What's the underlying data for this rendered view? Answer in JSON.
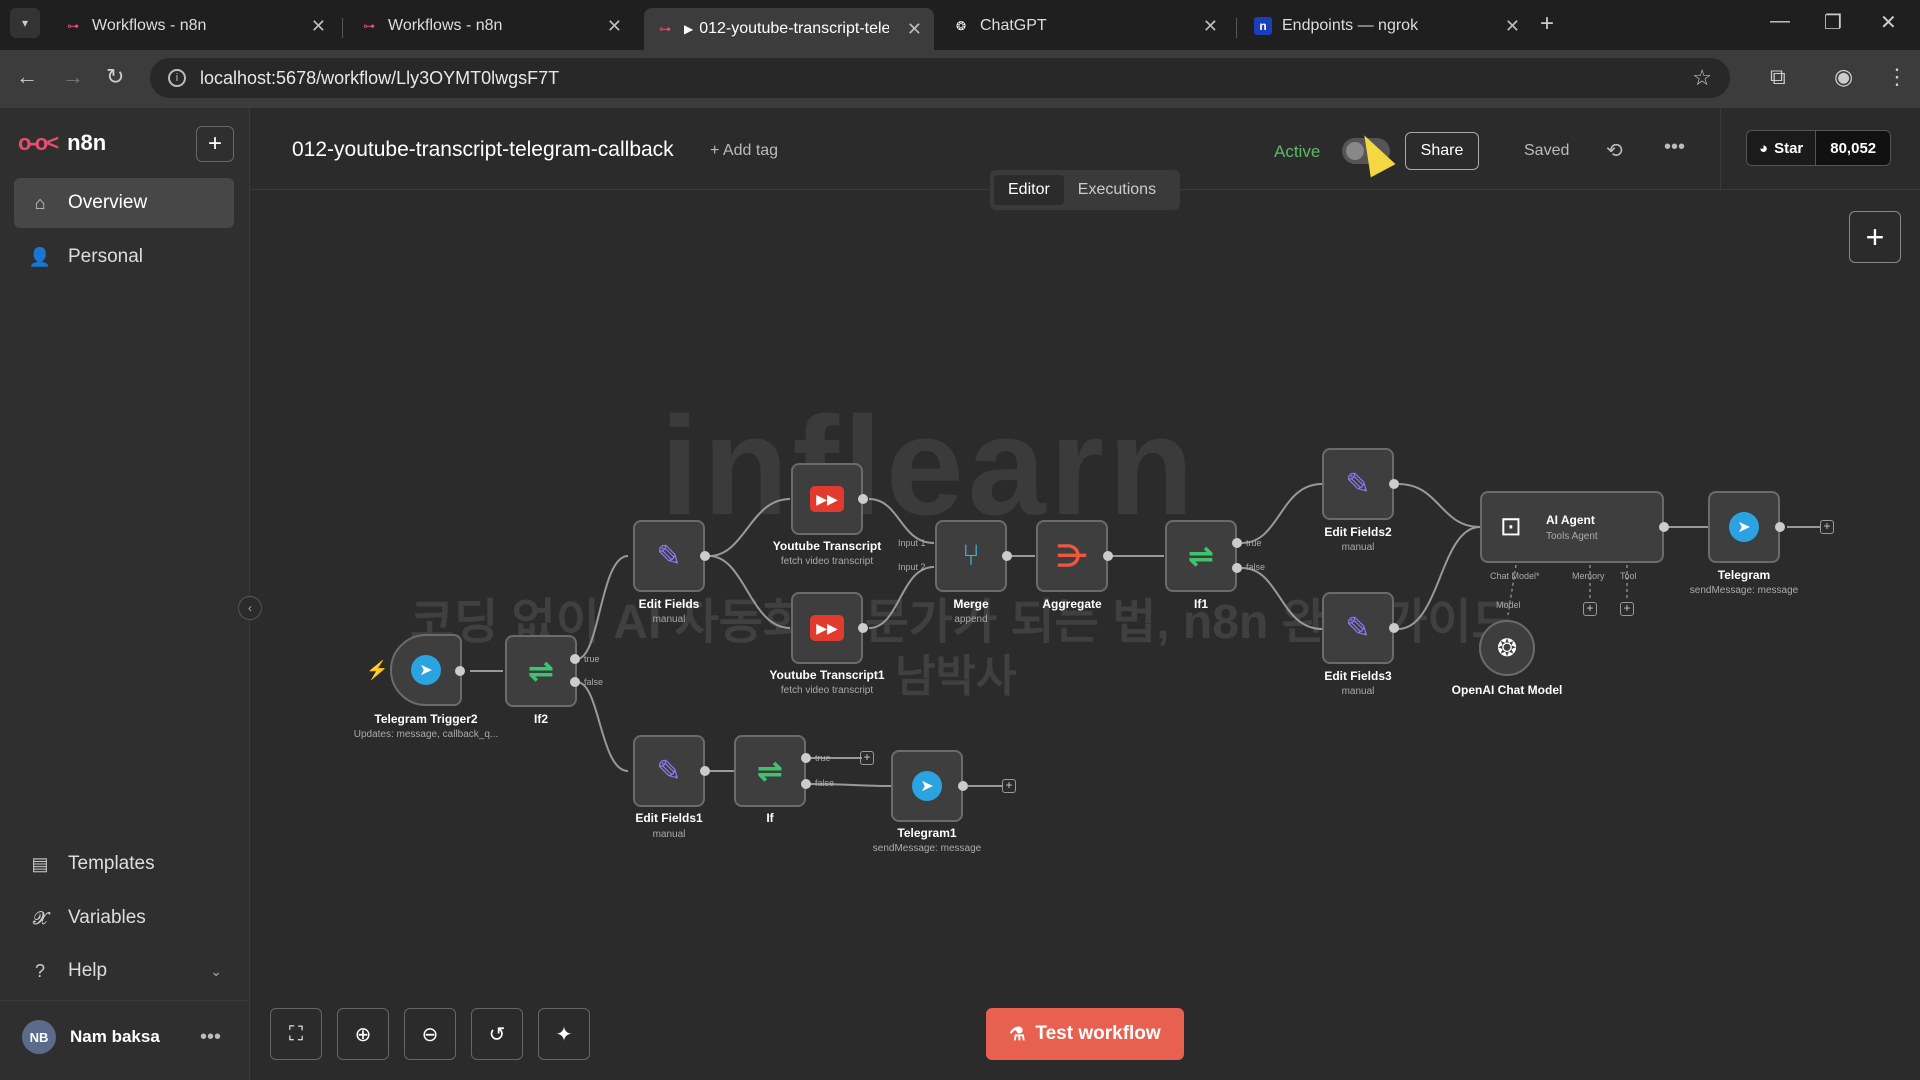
{
  "browser": {
    "tabs": [
      {
        "title": "Workflows - n8n",
        "active": false
      },
      {
        "title": "Workflows - n8n",
        "active": false
      },
      {
        "title": "012-youtube-transcript-tele",
        "active": true
      },
      {
        "title": "ChatGPT",
        "active": false
      },
      {
        "title": "Endpoints — ngrok",
        "active": false
      }
    ],
    "url": "localhost:5678/workflow/Lly3OYMT0lwgsF7T"
  },
  "sidebar": {
    "brand": "n8n",
    "items": [
      {
        "label": "Overview",
        "icon": "home-icon"
      },
      {
        "label": "Personal",
        "icon": "user-icon"
      }
    ],
    "bottom_items": [
      {
        "label": "Templates",
        "icon": "templates-icon"
      },
      {
        "label": "Variables",
        "icon": "variables-icon"
      },
      {
        "label": "Help",
        "icon": "help-icon"
      }
    ],
    "user": {
      "initials": "NB",
      "name": "Nam baksa"
    }
  },
  "header": {
    "workflow_title": "012-youtube-transcript-telegram-callback",
    "add_tag": "+ Add tag",
    "active_label": "Active",
    "share": "Share",
    "saved": "Saved",
    "github_star": "Star",
    "github_count": "80,052",
    "modes": [
      "Editor",
      "Executions"
    ]
  },
  "watermark": {
    "line1": "inflearn",
    "line2": "코딩 없이 AI 자동화 전문가가 되는 법, n8n 완벽 가이드",
    "line3": "남박사"
  },
  "nodes": {
    "telegram_trigger": {
      "label": "Telegram Trigger2",
      "sub": "Updates: message, callback_q..."
    },
    "if2": {
      "label": "If2",
      "true": "true",
      "false": "false"
    },
    "edit_fields": {
      "label": "Edit Fields",
      "sub": "manual"
    },
    "yt1": {
      "label": "Youtube Transcript",
      "sub": "fetch video transcript"
    },
    "yt2": {
      "label": "Youtube Transcript1",
      "sub": "fetch video transcript"
    },
    "merge": {
      "label": "Merge",
      "sub": "append",
      "in1": "Input 1",
      "in2": "Input 2"
    },
    "aggregate": {
      "label": "Aggregate"
    },
    "if1": {
      "label": "If1",
      "true": "true",
      "false": "false"
    },
    "edit2": {
      "label": "Edit Fields2",
      "sub": "manual"
    },
    "edit3": {
      "label": "Edit Fields3",
      "sub": "manual"
    },
    "agent": {
      "label": "AI Agent",
      "sub": "Tools Agent",
      "chat_model": "Chat Model*",
      "memory": "Memory",
      "tool": "Tool"
    },
    "openai": {
      "label": "OpenAI Chat Model",
      "model": "Model"
    },
    "telegram": {
      "label": "Telegram",
      "sub": "sendMessage: message"
    },
    "edit1": {
      "label": "Edit Fields1",
      "sub": "manual"
    },
    "if": {
      "label": "If",
      "true": "true",
      "false": "false"
    },
    "telegram1": {
      "label": "Telegram1",
      "sub": "sendMessage: message"
    }
  },
  "footer": {
    "test_workflow": "Test workflow"
  }
}
